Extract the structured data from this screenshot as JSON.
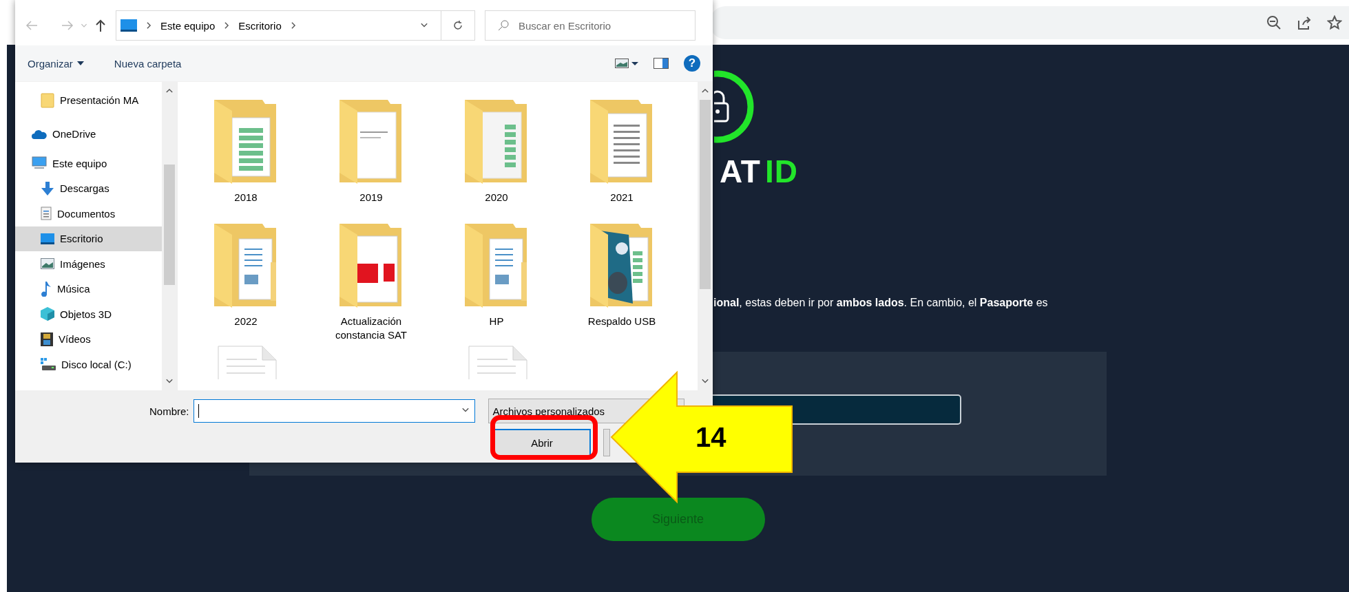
{
  "page": {
    "logo": {
      "white_text": "AT",
      "green_text": "ID"
    },
    "paragraph": "**ional**, estas deben ir por **ambos lados**. En cambio, el **Pasaporte** es",
    "next_button": {
      "label": "Siguiente",
      "disabled": true
    }
  },
  "dialog": {
    "path": [
      "Este equipo",
      "Escritorio"
    ],
    "search": {
      "placeholder": "Buscar en Escritorio"
    },
    "commands": [
      {
        "label": "Organizar",
        "kind": "menu"
      },
      {
        "label": "Nueva carpeta",
        "kind": "action"
      }
    ],
    "help": "?",
    "sidebar": {
      "pinned": [
        {
          "label": "Presentación MA",
          "kind": "folder",
          "selected": false
        }
      ],
      "items": [
        {
          "label": "OneDrive",
          "kind": "cloud",
          "selected": false
        },
        {
          "label": "Este equipo",
          "kind": "computer",
          "selected": false,
          "children": [
            {
              "label": "Descargas",
              "kind": "download",
              "selected": false
            },
            {
              "label": "Documentos",
              "kind": "documents",
              "selected": false
            },
            {
              "label": "Escritorio",
              "kind": "desktop",
              "selected": true
            },
            {
              "label": "Imágenes",
              "kind": "images",
              "selected": false
            },
            {
              "label": "Música",
              "kind": "music",
              "selected": false
            },
            {
              "label": "Objetos 3D",
              "kind": "objects",
              "selected": false
            },
            {
              "label": "Vídeos",
              "kind": "videos",
              "selected": false
            },
            {
              "label": "Disco local (C:)",
              "kind": "disk",
              "selected": false
            }
          ]
        }
      ]
    },
    "files": [
      {
        "label": "2018",
        "kind": "excel"
      },
      {
        "label": "2019",
        "kind": "doc"
      },
      {
        "label": "2020",
        "kind": "sheet"
      },
      {
        "label": "2021",
        "kind": "word"
      },
      {
        "label": "2022",
        "kind": "plain"
      },
      {
        "label": "Actualización constancia SAT",
        "kind": "pdf"
      },
      {
        "label": "HP",
        "kind": "plain"
      },
      {
        "label": "Respaldo USB",
        "kind": "photo"
      },
      {
        "kind": "document"
      },
      {
        "kind": "empty"
      },
      {
        "kind": "document"
      }
    ],
    "filename": {
      "label": "Nombre:"
    },
    "filetype": "Archivos personalizados",
    "open_button": "Abrir"
  },
  "callout": {
    "step": "14"
  }
}
